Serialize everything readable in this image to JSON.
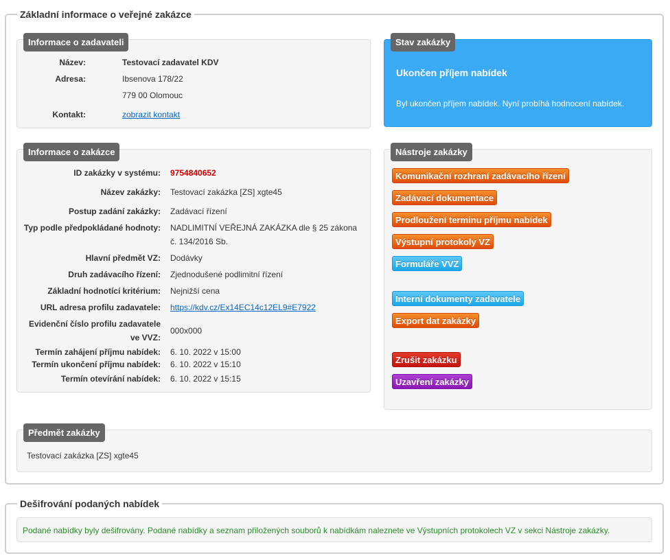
{
  "section_main": {
    "legend": "Základní informace o veřejné zakázce"
  },
  "contracting_authority": {
    "badge": "Informace o zadavateli",
    "name_label": "Název:",
    "name_value": "Testovací zadavatel KDV",
    "address_label": "Adresa:",
    "address_line1": "Ibsenova 178/22",
    "address_line2": "779 00 Olomouc",
    "contact_label": "Kontakt:",
    "contact_link": "zobrazit kontakt"
  },
  "status": {
    "badge": "Stav zakázky",
    "title": "Ukončen příjem nabídek",
    "text": "Byl ukončen příjem nabídek. Nyní probíhá hodnocení nabídek.",
    "color": "#3aaaf5"
  },
  "contract_info": {
    "badge": "Informace o zakázce",
    "rows": [
      {
        "label": "ID zakázky v systému:",
        "value": "9754840652"
      },
      {
        "label": "Název zakázky:",
        "value": "Testovací zakázka [ZS] xgte45"
      },
      {
        "label": "Postup zadání zakázky:",
        "value": "Zadávací řízení"
      },
      {
        "label": "Typ podle předpokládané hodnoty:",
        "value_line1": "NADLIMITNÍ VEŘEJNÁ ZAKÁZKA dle § 25 zákona",
        "value_line2": "č. 134/2016 Sb."
      },
      {
        "label": "Hlavní předmět VZ:",
        "value": "Dodávky"
      },
      {
        "label": "Druh zadávacího řízení:",
        "value": "Zjednodušené podlimitní řízení"
      },
      {
        "label": "Základní hodnotící kritérium:",
        "value": "Nejnižší cena"
      },
      {
        "label": "URL adresa profilu zadavatele:",
        "value": "https://kdv.cz/Ex14EC14c12EL9#E7922"
      },
      {
        "label_line1": "Evidenční číslo profilu zadavatele",
        "label_line2": "ve VVZ:",
        "value": "000x000"
      },
      {
        "label": "Termín zahájení příjmu nabídek:",
        "value": "6. 10. 2022 v 15:00"
      },
      {
        "label": "Termín ukončení příjmu nabídek:",
        "value": "6. 10. 2022 v 15:10"
      },
      {
        "label": "Termín otevírání nabídek:",
        "value": "6. 10. 2022 v 15:15"
      }
    ],
    "id_color": "#cc0000"
  },
  "tools": {
    "badge": "Nástroje zakázky",
    "buttons": [
      {
        "label": "Komunikační rozhraní zadávacího řízení"
      },
      {
        "label": "Zadávací dokumentace"
      },
      {
        "label": "Prodloužení terminu příjmu nabídek"
      },
      {
        "label": "Výstupní protokoly VZ"
      },
      {
        "label": "Formuláře VVZ"
      },
      {
        "label": "Interní dokumenty zadavatele"
      },
      {
        "label": "Export dat zakázky"
      },
      {
        "label": "Zrušit zakázku"
      },
      {
        "label": "Uzavření zakázky"
      }
    ]
  },
  "subject": {
    "badge": "Předmět zakázky",
    "text": "Testovací zakázka [ZS] xgte45"
  },
  "section_decrypt": {
    "legend": "Dešifrování podaných nabídek",
    "message": "Podané nabídky byly dešifrovány. Podané nabídky a seznam přiložených souborů k nabídkám naleznete ve Výstupních protokolech VZ v sekci Nástroje zakázky.",
    "message_color": "#2a8a2a"
  }
}
